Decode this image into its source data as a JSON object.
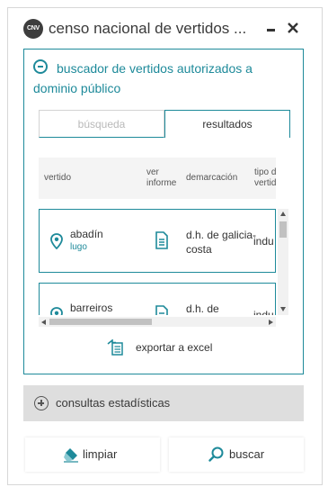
{
  "window": {
    "badge": "CNV",
    "title": "censo nacional de vertidos ...",
    "minimize_icon": "minimize-icon",
    "close_icon": "close-icon"
  },
  "panel": {
    "title": "buscador de vertidos autorizados a dominio público",
    "tabs": [
      {
        "label": "búsqueda",
        "active": false
      },
      {
        "label": "resultados",
        "active": true
      }
    ]
  },
  "table": {
    "columns": [
      "vertido",
      "ver informe",
      "demarcación",
      "tipo de vertido"
    ],
    "rows": [
      {
        "name": "abadín",
        "province": "lugo",
        "demarcation": "d.h. de galicia-costa",
        "type": "indu"
      },
      {
        "name": "barreiros",
        "province": "",
        "demarcation": "d.h. de",
        "type": "indu"
      }
    ]
  },
  "export": {
    "label": "exportar a excel",
    "icon": "excel-export-icon"
  },
  "stats": {
    "label": "consultas estadísticas",
    "icon": "plus-circle-icon"
  },
  "buttons": {
    "clear": {
      "label": "limpiar",
      "icon": "eraser-icon"
    },
    "search": {
      "label": "buscar",
      "icon": "search-icon"
    }
  },
  "colors": {
    "accent": "#1e8a9a",
    "stats_bg": "#dedede"
  }
}
